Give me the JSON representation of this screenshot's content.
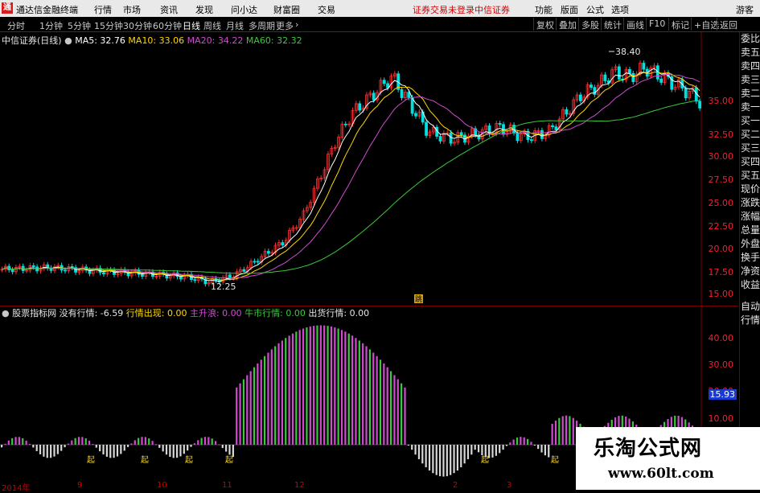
{
  "window": {
    "app_name": "通达信金融终端",
    "logo_char": "通"
  },
  "menu": [
    "行情",
    "市场",
    "资讯",
    "发现",
    "问小达",
    "财富圈",
    "交易"
  ],
  "warning": [
    "证券交易未登录",
    "中信证券"
  ],
  "right_menu": [
    "功能",
    "版面",
    "公式",
    "选项"
  ],
  "guest": "游客",
  "periods": [
    "分时",
    "1分钟",
    "5分钟",
    "15分钟",
    "30分钟",
    "60分钟",
    "日线",
    "周线",
    "月线",
    "多周期",
    "更多"
  ],
  "active_period": "日线",
  "tools": [
    "复权",
    "叠加",
    "多股",
    "统计",
    "画线",
    "F10",
    "标记",
    "+自选",
    "返回"
  ],
  "stock_title": "中信证券(日线)",
  "ma": [
    {
      "label": "MA5: 32.76",
      "color": "#ffffff"
    },
    {
      "label": "MA10: 33.06",
      "color": "#ffd700"
    },
    {
      "label": "MA20: 34.22",
      "color": "#d04bd0"
    },
    {
      "label": "MA60: 32.32",
      "color": "#3cc83c"
    }
  ],
  "price_axis": [
    "35.00",
    "32.50",
    "30.00",
    "27.50",
    "25.00",
    "22.50",
    "20.00",
    "17.50",
    "15.00"
  ],
  "high_label": "38.40",
  "low_label": "12.25",
  "marker": "跳",
  "side_panel": [
    "委比",
    "卖五",
    "卖四",
    "卖三",
    "卖二",
    "卖一",
    "买一",
    "买二",
    "买三",
    "买四",
    "买五",
    "现价",
    "涨跌",
    "涨幅",
    "总量",
    "外盘",
    "换手",
    "净资",
    "收益"
  ],
  "side_bottom": [
    "自动",
    "行情"
  ],
  "indicator": {
    "name": "股票指标网",
    "items": [
      {
        "label": "没有行情: -6.59",
        "color": "#e6e6e6"
      },
      {
        "label": "行情出现: 0.00",
        "color": "#ffd700"
      },
      {
        "label": "主升浪: 0.00",
        "color": "#d04bd0"
      },
      {
        "label": "牛市行情: 0.00",
        "color": "#3cc83c"
      },
      {
        "label": "出货行情: 0.00",
        "color": "#e6e6e6"
      }
    ],
    "axis": [
      "40.00",
      "30.00",
      "20.00",
      "10.00"
    ],
    "current": "15.93",
    "marker_char": "起"
  },
  "dates": [
    "2014年",
    "9",
    "10",
    "11",
    "12",
    "2",
    "3"
  ],
  "watermark": {
    "title": "乐淘公式网",
    "url": "www.60lt.com"
  },
  "colors": {
    "up": "#f23030",
    "down": "#00e0e0",
    "axis": "#c00000",
    "grid": "#7a0000"
  }
}
